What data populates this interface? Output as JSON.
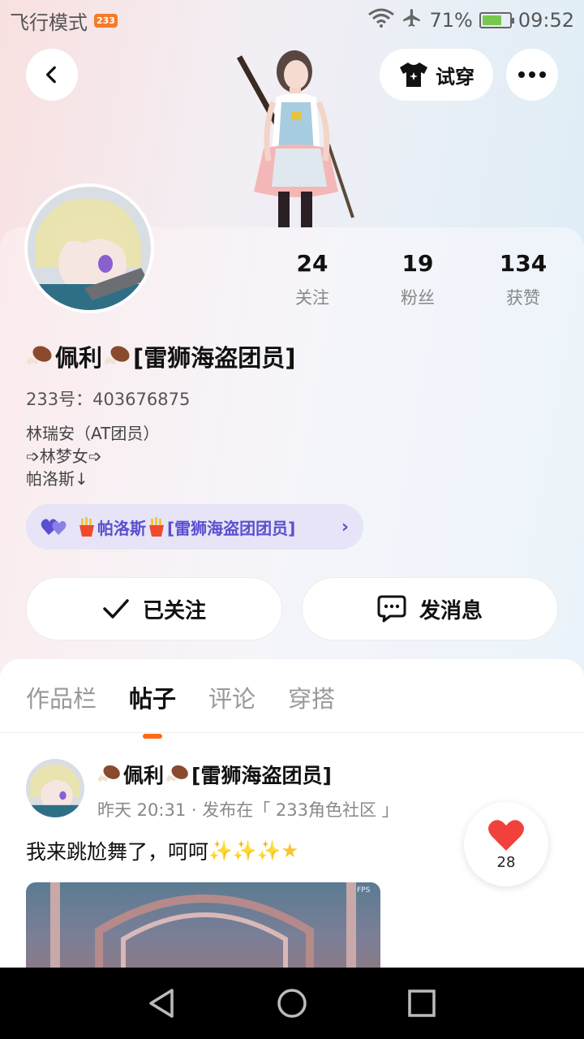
{
  "status_bar": {
    "mode": "飞行模式",
    "app_badge": "233",
    "battery": "71%",
    "battery_level": 0.71,
    "time": "09:52"
  },
  "header": {
    "try_on_label": "试穿"
  },
  "profile": {
    "stats": [
      {
        "value": "24",
        "label": "关注"
      },
      {
        "value": "19",
        "label": "粉丝"
      },
      {
        "value": "134",
        "label": "获赞"
      }
    ],
    "name": "佩利",
    "name_suffix": "[雷狮海盗团员]",
    "uid": "233号：403676875",
    "bio": [
      "林瑞安（AT团员）",
      "➩林梦女➩",
      "帕洛斯↓"
    ],
    "guild": {
      "name": "帕洛斯",
      "suffix": "[雷狮海盗团团员]"
    }
  },
  "actions": {
    "follow_label": "已关注",
    "message_label": "发消息"
  },
  "tabs": [
    {
      "label": "作品栏",
      "active": false
    },
    {
      "label": "帖子",
      "active": true
    },
    {
      "label": "评论",
      "active": false
    },
    {
      "label": "穿搭",
      "active": false
    }
  ],
  "post": {
    "author": "佩利",
    "author_suffix": "[雷狮海盗团员]",
    "meta": "昨天 20:31 · 发布在「 233角色社区 」",
    "text": "我来跳尬舞了，呵呵",
    "likes": "28",
    "image_overlay": "FPS"
  },
  "colors": {
    "accent": "#ff6a13",
    "guild_text": "#5a4fcf",
    "like_red": "#f2413b"
  }
}
